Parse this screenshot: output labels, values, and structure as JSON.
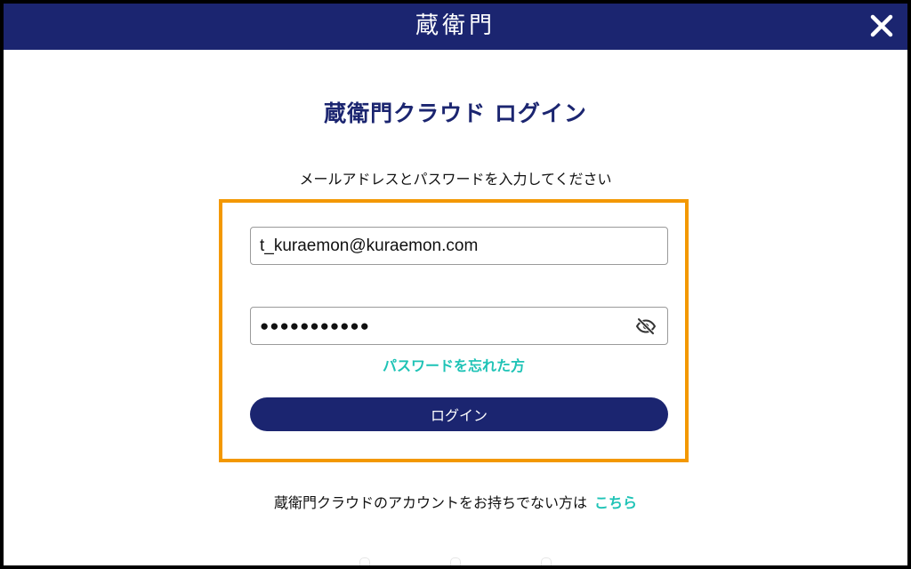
{
  "header": {
    "logo_text": "蔵衛門",
    "close_icon": "close-icon"
  },
  "login": {
    "title": "蔵衛門クラウド ログイン",
    "instruction": "メールアドレスとパスワードを入力してください",
    "email_value": "t_kuraemon@kuraemon.com",
    "password_masked": "●●●●●●●●●●●",
    "password_toggle_icon": "eye-slash-icon",
    "forgot_link": "パスワードを忘れた方",
    "submit_label": "ログイン"
  },
  "signup": {
    "prompt": "蔵衛門クラウドのアカウントをお持ちでない方は",
    "link": "こちら"
  },
  "colors": {
    "brand_navy": "#1b2570",
    "highlight_orange": "#f39800",
    "link_teal": "#1ec3b6"
  }
}
